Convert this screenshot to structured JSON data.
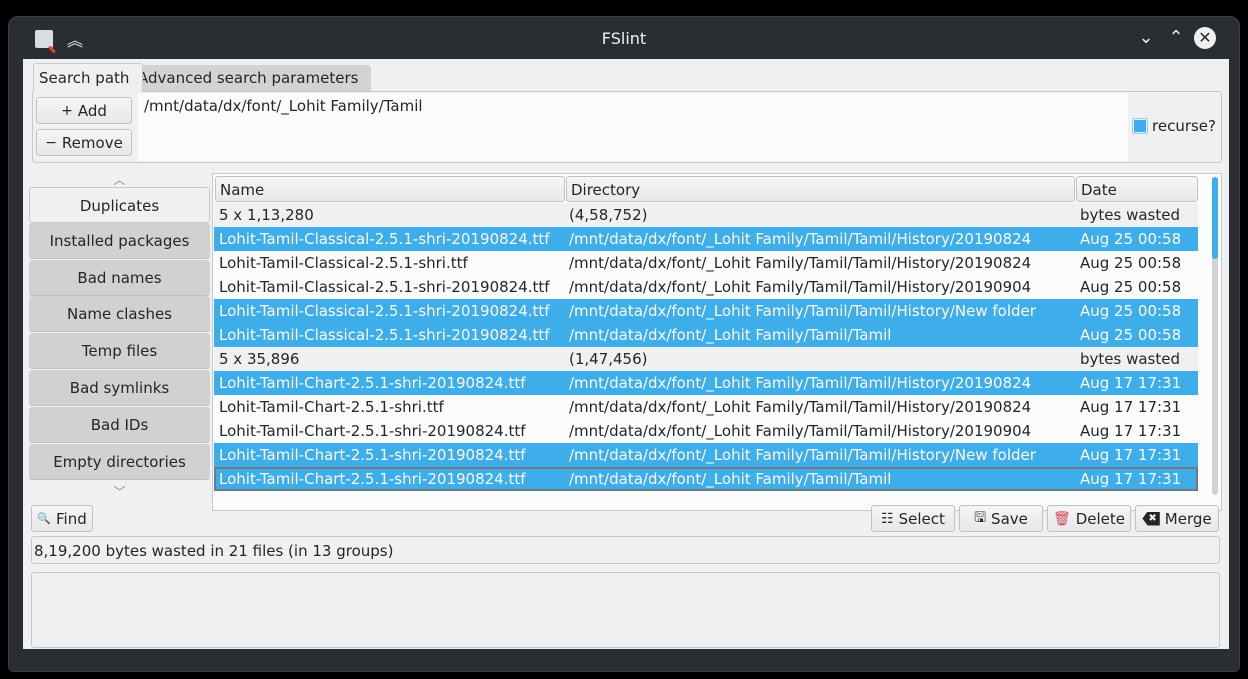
{
  "window": {
    "title": "FSlint",
    "icons": {
      "app": "fslint-app-icon",
      "keep_above": "keep-above-icon",
      "minimize": "minimize-icon",
      "maximize": "maximize-icon",
      "close": "close-icon"
    },
    "glyphs": {
      "keep_above": "︽",
      "minimize": "⌄",
      "maximize": "⌃",
      "close": "✕"
    }
  },
  "tabs": [
    {
      "label": "Search path",
      "active": true
    },
    {
      "label": "Advanced search parameters",
      "active": false
    }
  ],
  "search_path": {
    "add_label": "Add",
    "add_glyph": "+",
    "remove_label": "Remove",
    "remove_glyph": "−",
    "paths": [
      "/mnt/data/dx/font/_Lohit Family/Tamil"
    ],
    "recurse_label": "recurse?",
    "recurse_checked": true
  },
  "sidebar": {
    "scroll_up_glyph": "︿",
    "scroll_down_glyph": "﹀",
    "items": [
      {
        "label": "Duplicates",
        "active": true
      },
      {
        "label": "Installed packages"
      },
      {
        "label": "Bad names"
      },
      {
        "label": "Name clashes"
      },
      {
        "label": "Temp files"
      },
      {
        "label": "Bad symlinks"
      },
      {
        "label": "Bad IDs"
      },
      {
        "label": "Empty directories"
      }
    ]
  },
  "table": {
    "columns": [
      "Name",
      "Directory",
      "Date"
    ],
    "rows": [
      {
        "type": "group",
        "name": "5 x 1,13,280",
        "dir": "(4,58,752)",
        "date": "bytes wasted"
      },
      {
        "type": "sel",
        "name": "Lohit-Tamil-Classical-2.5.1-shri-20190824.ttf",
        "dir": "/mnt/data/dx/font/_Lohit Family/Tamil/Tamil/History/20190824",
        "date": "Aug 25 00:58"
      },
      {
        "type": "normal",
        "name": "Lohit-Tamil-Classical-2.5.1-shri.ttf",
        "dir": "/mnt/data/dx/font/_Lohit Family/Tamil/Tamil/History/20190824",
        "date": "Aug 25 00:58"
      },
      {
        "type": "normal",
        "name": "Lohit-Tamil-Classical-2.5.1-shri-20190824.ttf",
        "dir": "/mnt/data/dx/font/_Lohit Family/Tamil/Tamil/History/20190904",
        "date": "Aug 25 00:58"
      },
      {
        "type": "sel",
        "name": "Lohit-Tamil-Classical-2.5.1-shri-20190824.ttf",
        "dir": "/mnt/data/dx/font/_Lohit Family/Tamil/Tamil/History/New folder",
        "date": "Aug 25 00:58"
      },
      {
        "type": "sel",
        "name": "Lohit-Tamil-Classical-2.5.1-shri-20190824.ttf",
        "dir": "/mnt/data/dx/font/_Lohit Family/Tamil/Tamil",
        "date": "Aug 25 00:58"
      },
      {
        "type": "group",
        "name": "5 x 35,896",
        "dir": "(1,47,456)",
        "date": "bytes wasted"
      },
      {
        "type": "sel",
        "name": "Lohit-Tamil-Chart-2.5.1-shri-20190824.ttf",
        "dir": "/mnt/data/dx/font/_Lohit Family/Tamil/Tamil/History/20190824",
        "date": "Aug 17 17:31"
      },
      {
        "type": "normal",
        "name": "Lohit-Tamil-Chart-2.5.1-shri.ttf",
        "dir": "/mnt/data/dx/font/_Lohit Family/Tamil/Tamil/History/20190824",
        "date": "Aug 17 17:31"
      },
      {
        "type": "normal",
        "name": "Lohit-Tamil-Chart-2.5.1-shri-20190824.ttf",
        "dir": "/mnt/data/dx/font/_Lohit Family/Tamil/Tamil/History/20190904",
        "date": "Aug 17 17:31"
      },
      {
        "type": "sel",
        "name": "Lohit-Tamil-Chart-2.5.1-shri-20190824.ttf",
        "dir": "/mnt/data/dx/font/_Lohit Family/Tamil/Tamil/History/New folder",
        "date": "Aug 17 17:31"
      },
      {
        "type": "sel current",
        "name": "Lohit-Tamil-Chart-2.5.1-shri-20190824.ttf",
        "dir": "/mnt/data/dx/font/_Lohit Family/Tamil/Tamil",
        "date": "Aug 17 17:31"
      }
    ]
  },
  "actions": {
    "find_label": "Find",
    "find_glyph": "🔍",
    "select_label": "Select",
    "select_glyph": "☷",
    "save_label": "Save",
    "save_glyph": "🖫",
    "delete_label": "Delete",
    "delete_glyph": "🗑",
    "merge_label": "Merge",
    "merge_glyph": "✖"
  },
  "status": {
    "text": "8,19,200 bytes wasted in 21 files (in 13 groups)"
  },
  "colors": {
    "accent": "#3daee9",
    "window_bg": "#eff0f1",
    "titlebar": "#2a2e32",
    "text": "#232629"
  }
}
